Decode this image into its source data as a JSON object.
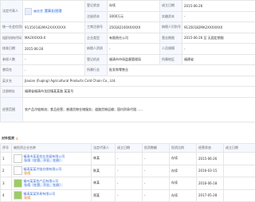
{
  "info": {
    "legal_rep_label": "法定代表人",
    "legal_rep_name": "林珍芳",
    "legal_rep_tag": "董事长/经理",
    "status_label": "登记状态",
    "status_value": "存续",
    "established_label": "成立日期",
    "established_value": "2015-06-26",
    "reg_capital_label": "注册资本",
    "reg_capital_value": "3000万元",
    "paid_capital_label": "实缴资本",
    "paid_capital_value": "-",
    "credit_code_label": "统一社会信用代码",
    "credit_code_value": "91350182MA2XXXXXXX",
    "reg_no_label": "工商注册号",
    "reg_no_value": "350182100XXXXXX",
    "tax_id_label": "纳税人识别号",
    "tax_id_value": "91350182MA2XXXXXXX",
    "org_code_label": "组织机构代码",
    "org_code_value": "MA2XXXXX-X",
    "company_type_label": "企业类型",
    "company_type_value": "有限责任公司",
    "term_label": "营业期限",
    "term_value": "2015-06-26 至 无固定期限",
    "approval_label": "核准日期",
    "approval_value": "2015-06-26",
    "taxpayer_label": "纳税人资质",
    "taxpayer_value": "-",
    "staff_label": "人员规模",
    "staff_value": "-",
    "insured_label": "参保人数",
    "insured_value": "-",
    "authority_label": "登记机关",
    "authority_value": "福清市市场监督管理局",
    "region_label": "所属地区",
    "region_value": "福建省",
    "former_name_label": "曾用名",
    "former_name_value": "-",
    "industry_label": "所属行业",
    "industry_value": "批发和零售业",
    "english_name_label": "英文名",
    "english_name_value": "Jiaxian (Fuqing) Agricultural Products Cold Chain Co., Ltd.",
    "address_label": "注册地址",
    "address_value": "福建省福清市龙田镇某某路 某某号",
    "scope_label": "经营范围",
    "scope_value": "农产品冷链物流；食品经营；普通货物仓储服务；道路货物运输；国内贸易代理……"
  },
  "investments": {
    "title": "对外投资",
    "count": "4",
    "headers": [
      "序号",
      "被投资企业名称",
      "法定代表人",
      "成立日期",
      "投资数额",
      "投资比例",
      "经营状态",
      "成立日期"
    ],
    "rows": [
      {
        "idx": "1",
        "name": "福清市某某农业发展有限公司",
        "sub": "存续（在营、开业、在册）",
        "rep": "林某",
        "capital": "-",
        "ratio": "-",
        "status": "存续",
        "date": "2015-06-26"
      },
      {
        "idx": "2",
        "name": "福清某某冷链仓储有限公司",
        "sub": "存续",
        "rep": "陈某",
        "capital": "-",
        "ratio": "-",
        "status": "存续",
        "date": "2016-03-15"
      },
      {
        "idx": "3",
        "name": "福州某某农产品有限公司",
        "sub": "存续（在营、开业、在册）",
        "rep": "林某",
        "capital": "-",
        "ratio": "-",
        "status": "存续",
        "date": "2016-06-18"
      },
      {
        "idx": "4",
        "name": "福清某某贸易有限公司",
        "sub": "存续",
        "rep": "郑某",
        "capital": "-",
        "ratio": "-",
        "status": "存续",
        "date": "2017-05-28"
      }
    ]
  }
}
